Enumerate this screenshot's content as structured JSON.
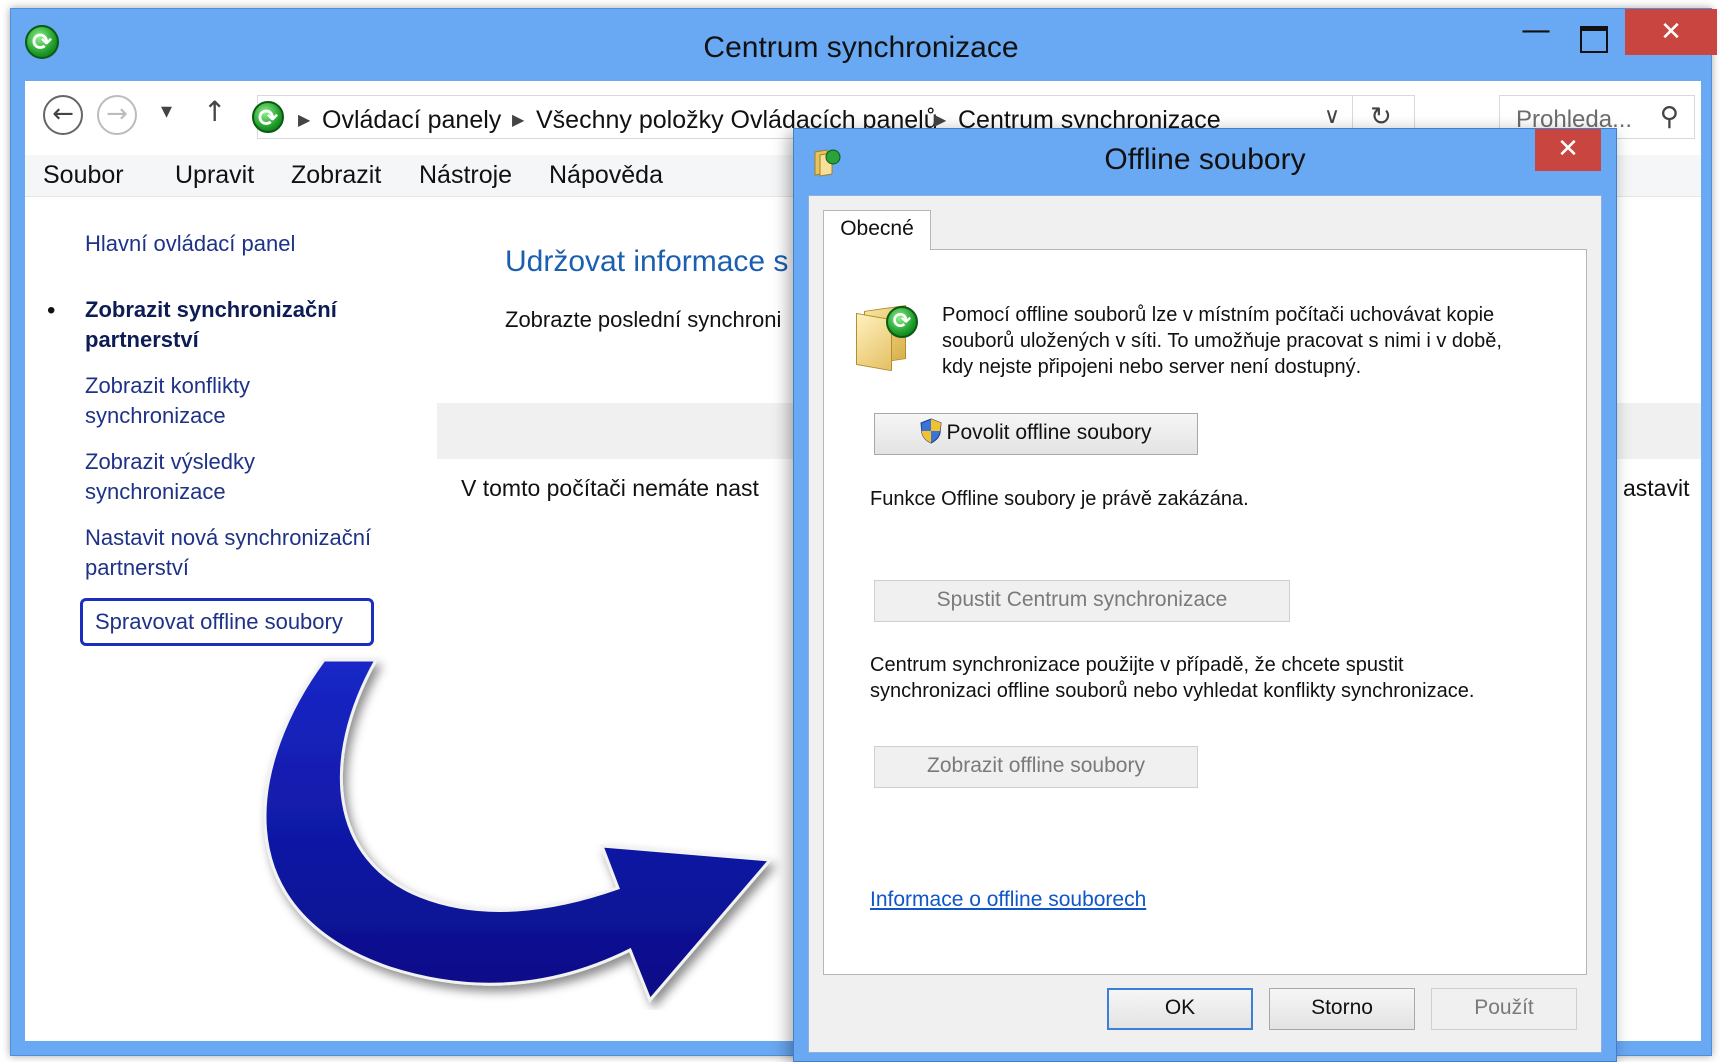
{
  "window": {
    "title": "Centrum synchronizace",
    "minimize_glyph": "—",
    "close_glyph": "✕"
  },
  "address_bar": {
    "back_glyph": "←",
    "forward_glyph": "→",
    "dropdown_glyph": "▾",
    "up_glyph": "↑",
    "breadcrumbs": [
      "Ovládací panely",
      "Všechny položky Ovládacích panelů",
      "Centrum synchronizace"
    ],
    "separator_glyph": "▶",
    "history_glyph": "∨",
    "refresh_glyph": "↻",
    "search_placeholder": "Prohleda...",
    "search_icon_glyph": "⚲"
  },
  "menubar": {
    "items": [
      "Soubor",
      "Upravit",
      "Zobrazit",
      "Nástroje",
      "Nápověda"
    ]
  },
  "sidebar": {
    "home": "Hlavní ovládací panel",
    "bullet": "•",
    "items": [
      {
        "line1": "Zobrazit synchronizační",
        "line2": "partnerství"
      },
      {
        "line1": "Zobrazit konflikty",
        "line2": "synchronizace"
      },
      {
        "line1": "Zobrazit výsledky",
        "line2": "synchronizace"
      },
      {
        "line1": "Nastavit nová synchronizační",
        "line2": "partnerství"
      },
      {
        "line1": "Spravovat offline soubory"
      }
    ]
  },
  "content": {
    "title": "Udržovat informace s",
    "description": "Zobrazte poslední synchroni",
    "empty_message": "V tomto počítači nemáte nast",
    "right_fragment": "astavit",
    "help_glyph": "?"
  },
  "dialog": {
    "title": "Offline soubory",
    "close_glyph": "✕",
    "tab": "Obecné",
    "intro_lines": [
      "Pomocí offline souborů lze v místním počítači uchovávat kopie",
      "souborů uložených v síti. To umožňuje pracovat s nimi i v době,",
      "kdy nejste připojeni nebo server není dostupný."
    ],
    "enable_button": "Povolit offline soubory",
    "status": "Funkce Offline soubory je právě zakázána.",
    "sync_center_button": "Spustit Centrum synchronizace",
    "sync_center_lines": [
      "Centrum synchronizace použijte v případě, že chcete spustit",
      "synchronizaci offline souborů nebo vyhledat konflikty synchronizace."
    ],
    "view_files_button": "Zobrazit offline soubory",
    "info_link": "Informace o offline souborech",
    "ok_button": "OK",
    "cancel_button": "Storno",
    "apply_button": "Použít"
  },
  "colors": {
    "window_frame": "#69a8f2",
    "close_red": "#c9453f",
    "link_blue": "#1e3287",
    "annotation_arrow": "#0a0f9c"
  }
}
